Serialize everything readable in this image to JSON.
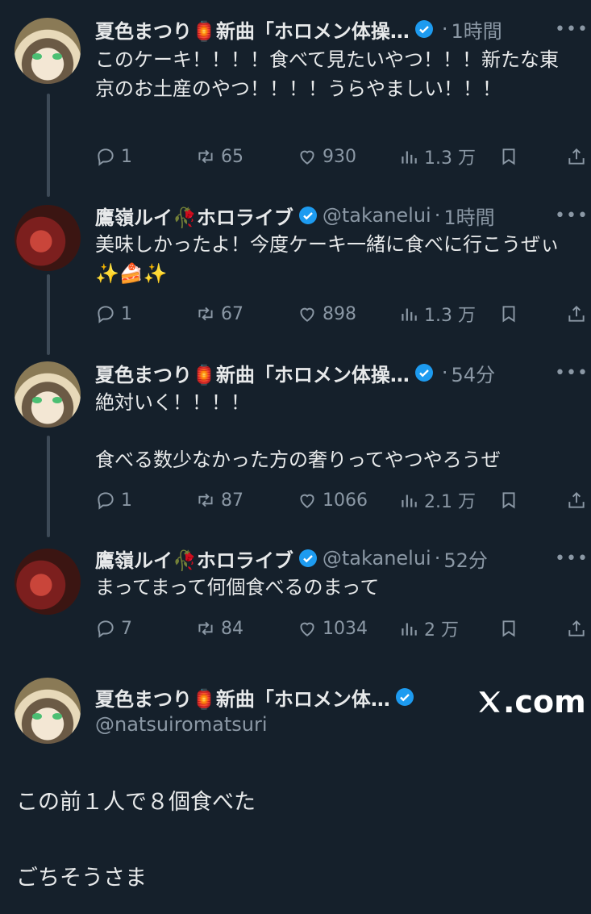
{
  "colors": {
    "background": "#15202b",
    "text": "#e7e9ea",
    "muted": "#8b98a5",
    "verified": "#1d9bf0"
  },
  "tweets": [
    {
      "name": "夏色まつり🏮新曲「ホロメン体操…",
      "handle": "",
      "time": "1時間",
      "text": "このケーキ！！！！食べて見たいやつ！！！新たな東京のお土産のやつ！！！！うらやましい！！！",
      "replies": "1",
      "retweets": "65",
      "likes": "930",
      "views": "1.3 万"
    },
    {
      "name": "鷹嶺ルイ🥀ホロライブ",
      "handle": "@takanelui",
      "time": "1時間",
      "text": "美味しかったよ！今度ケーキ一緒に食べに行こうぜぃ✨🍰✨",
      "replies": "1",
      "retweets": "67",
      "likes": "898",
      "views": "1.3 万"
    },
    {
      "name": "夏色まつり🏮新曲「ホロメン体操…",
      "handle": "",
      "time": "54分",
      "text_line1": "絶対いく！！！！",
      "text_line2": "食べる数少なかった方の奢りってやつやろうぜ",
      "replies": "1",
      "retweets": "87",
      "likes": "1066",
      "views": "2.1 万"
    },
    {
      "name": "鷹嶺ルイ🥀ホロライブ",
      "handle": "@takanelui",
      "time": "52分",
      "text": "まってまって何個食べるのまって",
      "replies": "7",
      "retweets": "84",
      "likes": "1034",
      "views": "2 万"
    }
  ],
  "focused_tweet": {
    "name": "夏色まつり🏮新曲「ホロメン体…",
    "handle": "@natsuiromatsuri",
    "line1": "この前１人で８個食べた",
    "line2": "ごちそうさま"
  },
  "brand": {
    "logo_text": ".com"
  }
}
